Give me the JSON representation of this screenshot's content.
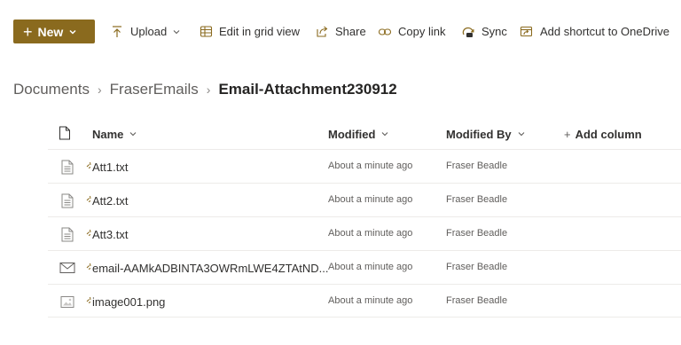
{
  "toolbar": {
    "new_label": "New",
    "upload_label": "Upload",
    "grid_label": "Edit in grid view",
    "share_label": "Share",
    "copy_link_label": "Copy link",
    "sync_label": "Sync",
    "shortcut_label": "Add shortcut to OneDrive",
    "accent_color": "#8a6a1e"
  },
  "breadcrumb": {
    "items": [
      "Documents",
      "FraserEmails"
    ],
    "current": "Email-Attachment230912"
  },
  "table": {
    "columns": {
      "name": "Name",
      "modified": "Modified",
      "modified_by": "Modified By",
      "add_column": "Add column"
    },
    "rows": [
      {
        "name": "Att1.txt",
        "modified": "About a minute ago",
        "modified_by": "Fraser Beadle",
        "icon": "text-file-icon"
      },
      {
        "name": "Att2.txt",
        "modified": "About a minute ago",
        "modified_by": "Fraser Beadle",
        "icon": "text-file-icon"
      },
      {
        "name": "Att3.txt",
        "modified": "About a minute ago",
        "modified_by": "Fraser Beadle",
        "icon": "text-file-icon"
      },
      {
        "name": "email-AAMkADBINTA3OWRmLWE4ZTAtND...",
        "modified": "About a minute ago",
        "modified_by": "Fraser Beadle",
        "icon": "email-file-icon"
      },
      {
        "name": "image001.png",
        "modified": "About a minute ago",
        "modified_by": "Fraser Beadle",
        "icon": "image-file-icon"
      }
    ]
  }
}
